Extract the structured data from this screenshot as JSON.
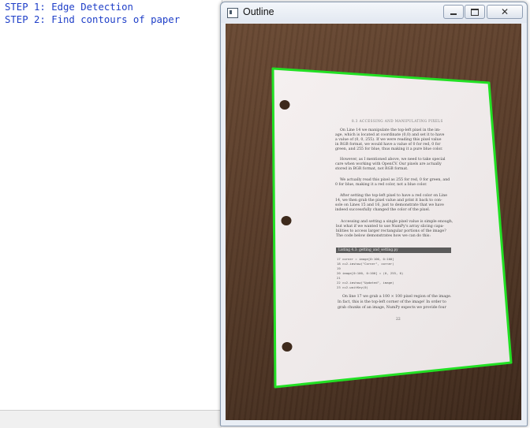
{
  "console": {
    "lines": [
      "STEP 1: Edge Detection",
      "STEP 2: Find contours of paper"
    ]
  },
  "window": {
    "title": "Outline",
    "controls": {
      "minimize": "minimize",
      "maximize": "maximize",
      "close": "close"
    }
  },
  "page": {
    "header": "8.3 ACCESSING AND MANIPULATING PIXELS",
    "para1": [
      "On Line 14 we manipulate the top-left pixel in the im-",
      "age, which is located at coordinate (0,0) and set it to have",
      "a value of (0, 0, 255). If we were reading this pixel value",
      "in RGB format, we would have a value of 0 for red, 0 for",
      "green, and 255 for blue, thus making it a pure blue color."
    ],
    "para2": [
      "However, as I mentioned above, we need to take special",
      "care when working with OpenCV. Our pixels are actually",
      "stored in BGR format, not RGB format."
    ],
    "para3": [
      "We actually read this pixel as 255 for red, 0 for green, and",
      "0 for blue, making it a red color, not a blue color."
    ],
    "para4": [
      "After setting the top-left pixel to have a red color on Line",
      "14, we then grab the pixel value and print it back to con-",
      "sole on Lines 15 and 16, just to demonstrate that we have",
      "indeed successfully changed the color of the pixel."
    ],
    "para5": [
      "Accessing and setting a single pixel value is simple enough,",
      "but what if we wanted to use NumPy's array slicing capa-",
      "bilities to access larger rectangular portions of the image?",
      "The code below demonstrates how we can do this:"
    ],
    "code_title": "Listing 4.3: getting_and_setting.py",
    "code": [
      "17 corner = image[0:100, 0:100]",
      "18 cv2.imshow(\"Corner\", corner)",
      "19",
      "20 image[0:100, 0:100] = (0, 255, 0)",
      "21",
      "22 cv2.imshow(\"Updated\", image)",
      "23 cv2.waitKey(0)"
    ],
    "para6": [
      "On line 17 we grab a 100 × 100 pixel region of the image.",
      "In fact, this is the top-left corner of the image! In order to",
      "grab chunks of an image, NumPy expects we provide four"
    ],
    "page_number": "22"
  },
  "colors": {
    "console_text": "#1f3fc8",
    "contour": "#22e024",
    "paper": "#f3eeee",
    "table": "#5a3d2a"
  },
  "icons": {
    "window_app": "window-app-icon",
    "minimize": "minimize-icon",
    "maximize": "maximize-icon",
    "close": "close-icon"
  }
}
